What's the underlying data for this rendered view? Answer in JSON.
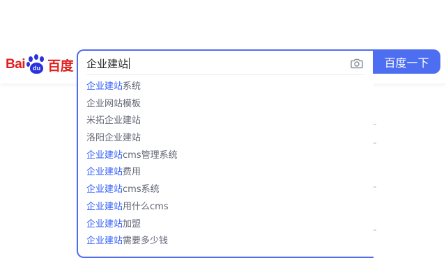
{
  "logo": {
    "bai": "Bai",
    "du": "du",
    "cn": "百度"
  },
  "search": {
    "value": "企业建站",
    "button_label": "百度一下",
    "camera_icon": "camera-icon"
  },
  "suggestions": [
    {
      "prefix": "企业建站",
      "rest": "系统"
    },
    {
      "prefix": "",
      "rest": "企业网站模板"
    },
    {
      "prefix": "",
      "rest": "米拓企业建站"
    },
    {
      "prefix": "",
      "rest": "洛阳企业建站"
    },
    {
      "prefix": "企业建站",
      "rest": "cms管理系统"
    },
    {
      "prefix": "企业建站",
      "rest": "费用"
    },
    {
      "prefix": "企业建站",
      "rest": "cms系统"
    },
    {
      "prefix": "企业建站",
      "rest": "用什么cms"
    },
    {
      "prefix": "企业建站",
      "rest": "加盟"
    },
    {
      "prefix": "企业建站",
      "rest": "需要多少钱"
    }
  ],
  "colors": {
    "accent": "#4e6ef2",
    "suggestion_text": "#626675",
    "suggestion_highlight": "#315efb",
    "logo_red": "#e02020",
    "logo_blue": "#2932e1"
  }
}
